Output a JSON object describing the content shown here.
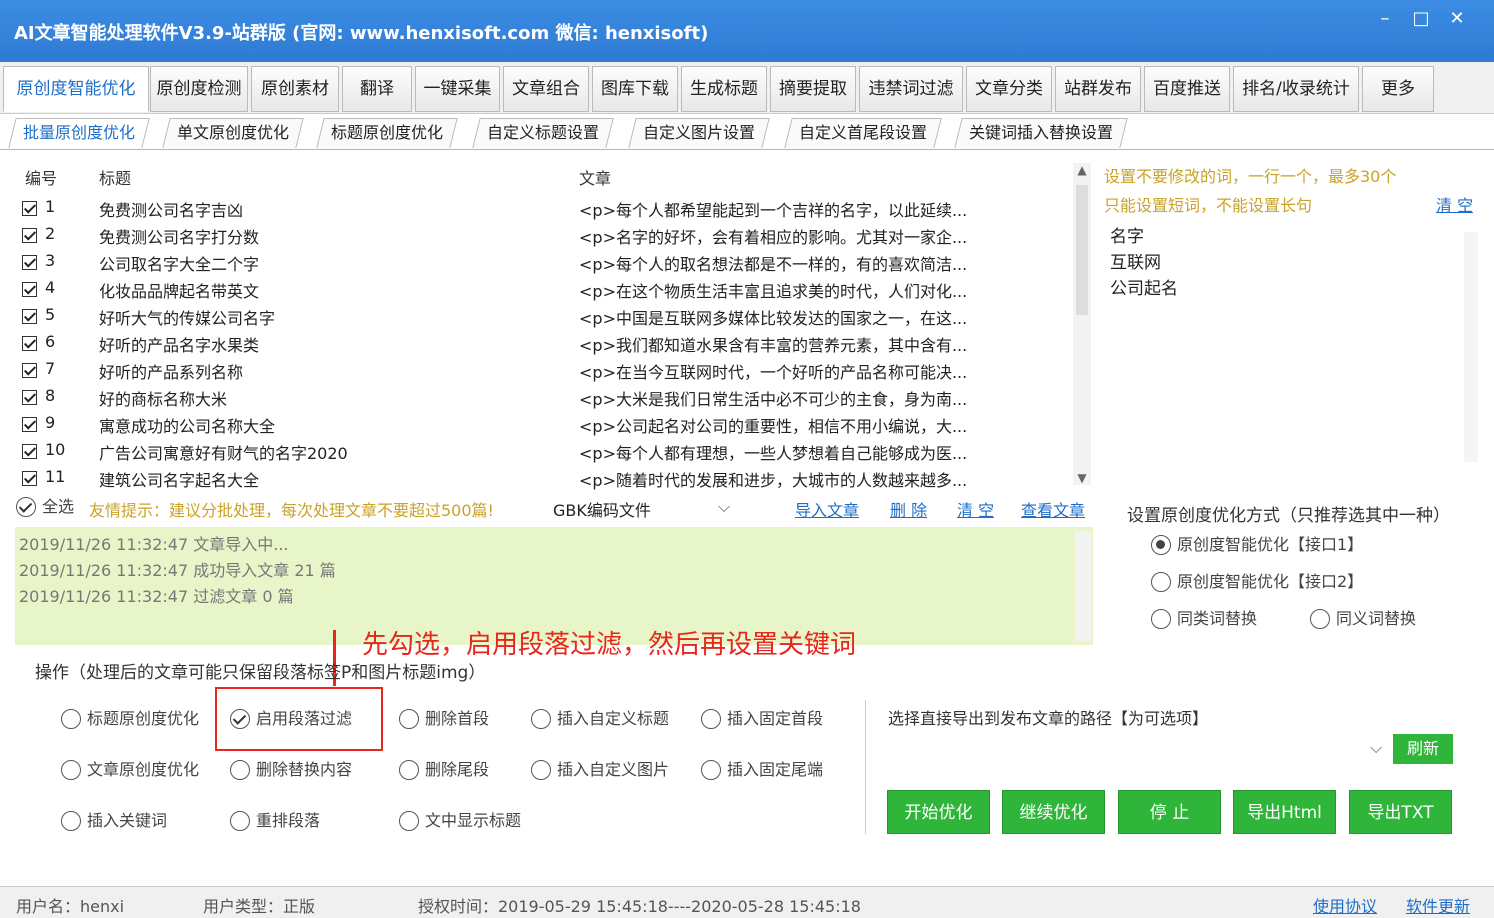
{
  "window": {
    "title": "AI文章智能处理软件V3.9-站群版 (官网: www.henxisoft.com 微信: henxisoft)",
    "minimize": "–",
    "maximize": "□",
    "close": "✕"
  },
  "main_tabs": [
    "原创度智能优化",
    "原创度检测",
    "原创素材",
    "翻译",
    "一键采集",
    "文章组合",
    "图库下载",
    "生成标题",
    "摘要提取",
    "违禁词过滤",
    "文章分类",
    "站群发布",
    "百度推送",
    "排名/收录统计",
    "更多"
  ],
  "sub_tabs": [
    "批量原创度优化",
    "单文原创度优化",
    "标题原创度优化",
    "自定义标题设置",
    "自定义图片设置",
    "自定义首尾段设置",
    "关键词插入替换设置"
  ],
  "list": {
    "headers": {
      "num": "编号",
      "title": "标题",
      "article": "文章"
    },
    "rows": [
      {
        "num": "1",
        "title": "免费测公司名字吉凶",
        "article": "<p>每个人都希望能起到一个吉祥的名字，以此延续..."
      },
      {
        "num": "2",
        "title": "免费测公司名字打分数",
        "article": "<p>名字的好坏，会有着相应的影响。尤其对一家企..."
      },
      {
        "num": "3",
        "title": "公司取名字大全二个字",
        "article": "<p>每个人的取名想法都是不一样的，有的喜欢简洁..."
      },
      {
        "num": "4",
        "title": "化妆品品牌起名带英文",
        "article": "<p>在这个物质生活丰富且追求美的时代，人们对化..."
      },
      {
        "num": "5",
        "title": "好听大气的传媒公司名字",
        "article": "<p>中国是互联网多媒体比较发达的国家之一，在这..."
      },
      {
        "num": "6",
        "title": "好听的产品名字水果类",
        "article": "<p>我们都知道水果含有丰富的营养元素，其中含有..."
      },
      {
        "num": "7",
        "title": "好听的产品系列名称",
        "article": "<p>在当今互联网时代，一个好听的产品名称可能决..."
      },
      {
        "num": "8",
        "title": "好的商标名称大米",
        "article": "<p>大米是我们日常生活中必不可少的主食，身为南..."
      },
      {
        "num": "9",
        "title": "寓意成功的公司名称大全",
        "article": "<p>公司起名对公司的重要性，相信不用小编说，大..."
      },
      {
        "num": "10",
        "title": "广告公司寓意好有财气的名字2020",
        "article": "<p>每个人都有理想，一些人梦想着自己能够成为医..."
      },
      {
        "num": "11",
        "title": "建筑公司名字起名大全",
        "article": "<p>随着时代的发展和进步，大城市的人数越来越多..."
      }
    ]
  },
  "keywords_panel": {
    "hint1": "设置不要修改的词，一行一个，最多30个",
    "hint2": "只能设置短词，不能设置长句",
    "clear": "清 空",
    "items": [
      "名字",
      "互联网",
      "公司起名"
    ]
  },
  "toolbar": {
    "select_all": "全选",
    "tip": "友情提示：建议分批处理，每次处理文章不要超过500篇!",
    "encoding": "GBK编码文件",
    "import": "导入文章",
    "delete": "删 除",
    "clear": "清 空",
    "view": "查看文章"
  },
  "log": [
    "2019/11/26 11:32:47 文章导入中...",
    "2019/11/26 11:32:47 成功导入文章 21 篇",
    "2019/11/26 11:32:47 过滤文章 0 篇"
  ],
  "method": {
    "label": "设置原创度优化方式（只推荐选其中一种）",
    "options": [
      "原创度智能优化【接口1】",
      "原创度智能优化【接口2】",
      "同类词替换",
      "同义词替换"
    ]
  },
  "annotation": "先勾选，启用段落过滤，然后再设置关键词",
  "operations": {
    "label": "操作（处理后的文章可能只保留段落标签P和图片标题img）",
    "options": [
      "标题原创度优化",
      "启用段落过滤",
      "删除首段",
      "插入自定义标题",
      "插入固定首段",
      "文章原创度优化",
      "删除替换内容",
      "删除尾段",
      "插入自定义图片",
      "插入固定尾端",
      "插入关键词",
      "重排段落",
      "文中显示标题"
    ]
  },
  "export": {
    "label": "选择直接导出到发布文章的路径【为可选项】",
    "refresh": "刷新",
    "buttons": [
      "开始优化",
      "继续优化",
      "停 止",
      "导出Html",
      "导出TXT"
    ]
  },
  "status": {
    "user": "用户名：henxi",
    "type": "用户类型：正版",
    "auth": "授权时间：2019-05-29 15:45:18----2020-05-28 15:45:18",
    "agreement": "使用协议",
    "update": "软件更新"
  },
  "colors": {
    "accent": "#1e6ec8",
    "title_bar": "#2f7ad3",
    "button_green": "#2fb53a",
    "annotation_red": "#e8261b",
    "hint": "#c9a227",
    "log_bg": "#e8f5c8"
  }
}
